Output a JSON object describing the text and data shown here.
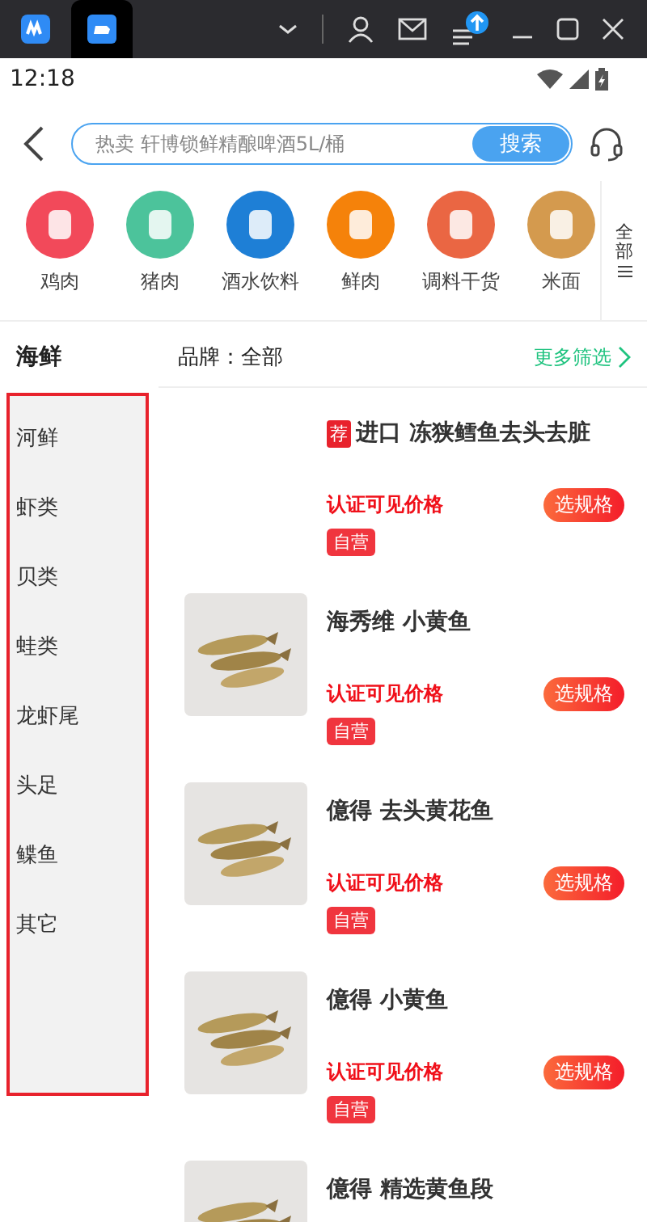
{
  "status_bar": {
    "time": "12:18"
  },
  "search": {
    "placeholder": "热卖 轩博锁鲜精酿啤酒5L/桶",
    "button": "搜索"
  },
  "categories": [
    {
      "label": "鸡肉",
      "color": "#f2495a"
    },
    {
      "label": "猪肉",
      "color": "#4cc39b"
    },
    {
      "label": "酒水饮料",
      "color": "#1e7fd6"
    },
    {
      "label": "鲜肉",
      "color": "#f5820a"
    },
    {
      "label": "调料干货",
      "color": "#ea6643"
    },
    {
      "label": "米面",
      "color": "#d49a4e"
    }
  ],
  "all_categories": "全部",
  "filter": {
    "category": "海鲜",
    "brand": "品牌：全部",
    "more": "更多筛选"
  },
  "sidebar": {
    "items": [
      "河鲜",
      "虾类",
      "贝类",
      "蛙类",
      "龙虾尾",
      "头足",
      "鲽鱼",
      "其它"
    ]
  },
  "products": [
    {
      "badge": "荐",
      "name": "进口 冻狭鳕鱼去头去脏",
      "price": "认证可见价格",
      "tag": "自营",
      "button": "选规格",
      "image": false
    },
    {
      "name": "海秀维 小黄鱼",
      "price": "认证可见价格",
      "tag": "自营",
      "button": "选规格",
      "image": true
    },
    {
      "name": "億得 去头黄花鱼",
      "price": "认证可见价格",
      "tag": "自营",
      "button": "选规格",
      "image": true
    },
    {
      "name": "億得 小黄鱼",
      "price": "认证可见价格",
      "tag": "自营",
      "button": "选规格",
      "image": true
    },
    {
      "name": "億得 精选黄鱼段",
      "image": true
    }
  ]
}
